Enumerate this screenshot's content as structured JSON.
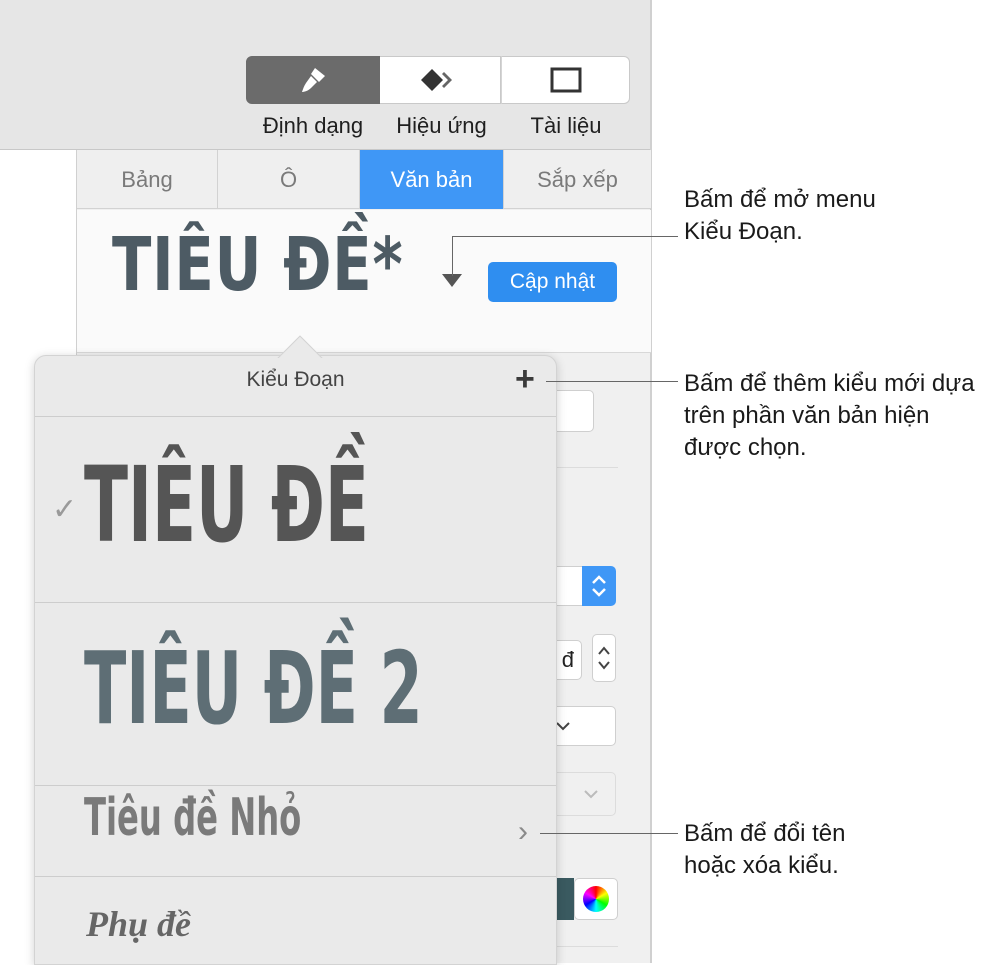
{
  "toolbar": {
    "format_label": "Định dạng",
    "animate_label": "Hiệu ứng",
    "document_label": "Tài liệu"
  },
  "tabs": [
    {
      "label": "Bảng",
      "active": false
    },
    {
      "label": "Ô",
      "active": false
    },
    {
      "label": "Văn bản",
      "active": true
    },
    {
      "label": "Sắp xếp",
      "active": false
    }
  ],
  "paragraph_style": {
    "current": "TIÊU ĐỀ*",
    "update_label": "Cập nhật"
  },
  "background_controls": {
    "unit_fragment": "đ"
  },
  "popover": {
    "title": "Kiểu Đoạn",
    "add_symbol": "+",
    "items": [
      {
        "label": "TIÊU ĐỀ",
        "selected": true
      },
      {
        "label": "TIÊU ĐỀ 2",
        "selected": false
      },
      {
        "label": "Tiêu đề Nhỏ",
        "selected": false
      },
      {
        "label": "Phụ đề",
        "selected": false
      }
    ],
    "check_symbol": "✓",
    "chevron_symbol": "›"
  },
  "callouts": {
    "menu": "Bấm để mở menu Kiểu Đoạn.",
    "add": "Bấm để thêm kiểu mới dựa trên phần văn bản hiện được chọn.",
    "rename": "Bấm để đổi tên hoặc xóa kiểu."
  },
  "colors": {
    "accent": "#3f97f6",
    "selected_segment": "#6b6b6b"
  }
}
